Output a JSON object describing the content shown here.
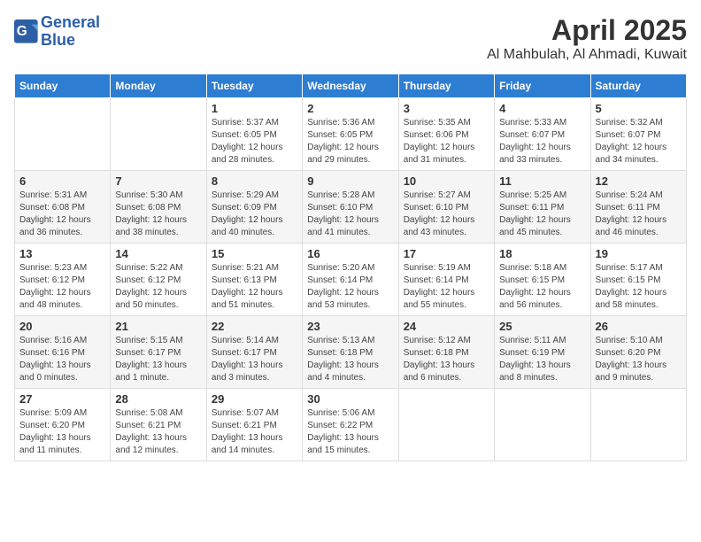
{
  "logo": {
    "line1": "General",
    "line2": "Blue"
  },
  "title": "April 2025",
  "location": "Al Mahbulah, Al Ahmadi, Kuwait",
  "days_of_week": [
    "Sunday",
    "Monday",
    "Tuesday",
    "Wednesday",
    "Thursday",
    "Friday",
    "Saturday"
  ],
  "weeks": [
    [
      {
        "num": "",
        "info": ""
      },
      {
        "num": "",
        "info": ""
      },
      {
        "num": "1",
        "info": "Sunrise: 5:37 AM\nSunset: 6:05 PM\nDaylight: 12 hours and 28 minutes."
      },
      {
        "num": "2",
        "info": "Sunrise: 5:36 AM\nSunset: 6:05 PM\nDaylight: 12 hours and 29 minutes."
      },
      {
        "num": "3",
        "info": "Sunrise: 5:35 AM\nSunset: 6:06 PM\nDaylight: 12 hours and 31 minutes."
      },
      {
        "num": "4",
        "info": "Sunrise: 5:33 AM\nSunset: 6:07 PM\nDaylight: 12 hours and 33 minutes."
      },
      {
        "num": "5",
        "info": "Sunrise: 5:32 AM\nSunset: 6:07 PM\nDaylight: 12 hours and 34 minutes."
      }
    ],
    [
      {
        "num": "6",
        "info": "Sunrise: 5:31 AM\nSunset: 6:08 PM\nDaylight: 12 hours and 36 minutes."
      },
      {
        "num": "7",
        "info": "Sunrise: 5:30 AM\nSunset: 6:08 PM\nDaylight: 12 hours and 38 minutes."
      },
      {
        "num": "8",
        "info": "Sunrise: 5:29 AM\nSunset: 6:09 PM\nDaylight: 12 hours and 40 minutes."
      },
      {
        "num": "9",
        "info": "Sunrise: 5:28 AM\nSunset: 6:10 PM\nDaylight: 12 hours and 41 minutes."
      },
      {
        "num": "10",
        "info": "Sunrise: 5:27 AM\nSunset: 6:10 PM\nDaylight: 12 hours and 43 minutes."
      },
      {
        "num": "11",
        "info": "Sunrise: 5:25 AM\nSunset: 6:11 PM\nDaylight: 12 hours and 45 minutes."
      },
      {
        "num": "12",
        "info": "Sunrise: 5:24 AM\nSunset: 6:11 PM\nDaylight: 12 hours and 46 minutes."
      }
    ],
    [
      {
        "num": "13",
        "info": "Sunrise: 5:23 AM\nSunset: 6:12 PM\nDaylight: 12 hours and 48 minutes."
      },
      {
        "num": "14",
        "info": "Sunrise: 5:22 AM\nSunset: 6:12 PM\nDaylight: 12 hours and 50 minutes."
      },
      {
        "num": "15",
        "info": "Sunrise: 5:21 AM\nSunset: 6:13 PM\nDaylight: 12 hours and 51 minutes."
      },
      {
        "num": "16",
        "info": "Sunrise: 5:20 AM\nSunset: 6:14 PM\nDaylight: 12 hours and 53 minutes."
      },
      {
        "num": "17",
        "info": "Sunrise: 5:19 AM\nSunset: 6:14 PM\nDaylight: 12 hours and 55 minutes."
      },
      {
        "num": "18",
        "info": "Sunrise: 5:18 AM\nSunset: 6:15 PM\nDaylight: 12 hours and 56 minutes."
      },
      {
        "num": "19",
        "info": "Sunrise: 5:17 AM\nSunset: 6:15 PM\nDaylight: 12 hours and 58 minutes."
      }
    ],
    [
      {
        "num": "20",
        "info": "Sunrise: 5:16 AM\nSunset: 6:16 PM\nDaylight: 13 hours and 0 minutes."
      },
      {
        "num": "21",
        "info": "Sunrise: 5:15 AM\nSunset: 6:17 PM\nDaylight: 13 hours and 1 minute."
      },
      {
        "num": "22",
        "info": "Sunrise: 5:14 AM\nSunset: 6:17 PM\nDaylight: 13 hours and 3 minutes."
      },
      {
        "num": "23",
        "info": "Sunrise: 5:13 AM\nSunset: 6:18 PM\nDaylight: 13 hours and 4 minutes."
      },
      {
        "num": "24",
        "info": "Sunrise: 5:12 AM\nSunset: 6:18 PM\nDaylight: 13 hours and 6 minutes."
      },
      {
        "num": "25",
        "info": "Sunrise: 5:11 AM\nSunset: 6:19 PM\nDaylight: 13 hours and 8 minutes."
      },
      {
        "num": "26",
        "info": "Sunrise: 5:10 AM\nSunset: 6:20 PM\nDaylight: 13 hours and 9 minutes."
      }
    ],
    [
      {
        "num": "27",
        "info": "Sunrise: 5:09 AM\nSunset: 6:20 PM\nDaylight: 13 hours and 11 minutes."
      },
      {
        "num": "28",
        "info": "Sunrise: 5:08 AM\nSunset: 6:21 PM\nDaylight: 13 hours and 12 minutes."
      },
      {
        "num": "29",
        "info": "Sunrise: 5:07 AM\nSunset: 6:21 PM\nDaylight: 13 hours and 14 minutes."
      },
      {
        "num": "30",
        "info": "Sunrise: 5:06 AM\nSunset: 6:22 PM\nDaylight: 13 hours and 15 minutes."
      },
      {
        "num": "",
        "info": ""
      },
      {
        "num": "",
        "info": ""
      },
      {
        "num": "",
        "info": ""
      }
    ]
  ]
}
